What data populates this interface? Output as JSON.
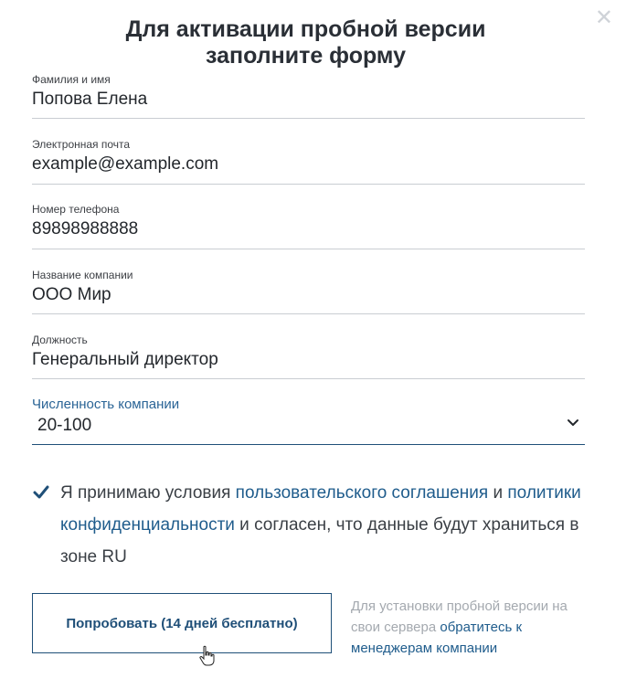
{
  "dialog": {
    "close_icon": "close-icon",
    "title_line1": "Для активации пробной версии",
    "title_line2": "заполните форму"
  },
  "form": {
    "name_label": "Фамилия и имя",
    "name_value": "Попова Елена",
    "email_label": "Электронная почта",
    "email_value": "example@example.com",
    "phone_label": "Номер телефона",
    "phone_value": "89898988888",
    "company_label": "Название компании",
    "company_value": "ООО Мир",
    "position_label": "Должность",
    "position_value": "Генеральный директор",
    "size_label": "Численность компании",
    "size_value": "20-100"
  },
  "consent": {
    "checked": true,
    "text1": "Я принимаю условия ",
    "link1": "пользовательского соглашения",
    "text2": " и ",
    "link2": "политики конфиденциальности",
    "text3": " и согласен, что данные будут храниться в зоне RU"
  },
  "actions": {
    "submit_label": "Попробовать (14 дней бесплатно)",
    "note_text": "Для установки пробной версии на свои сервера ",
    "note_link": "обратитесь к менеджерам компании"
  },
  "colors": {
    "accent": "#1f4f78",
    "link": "#1f5c8c",
    "muted": "#a4a9af"
  }
}
